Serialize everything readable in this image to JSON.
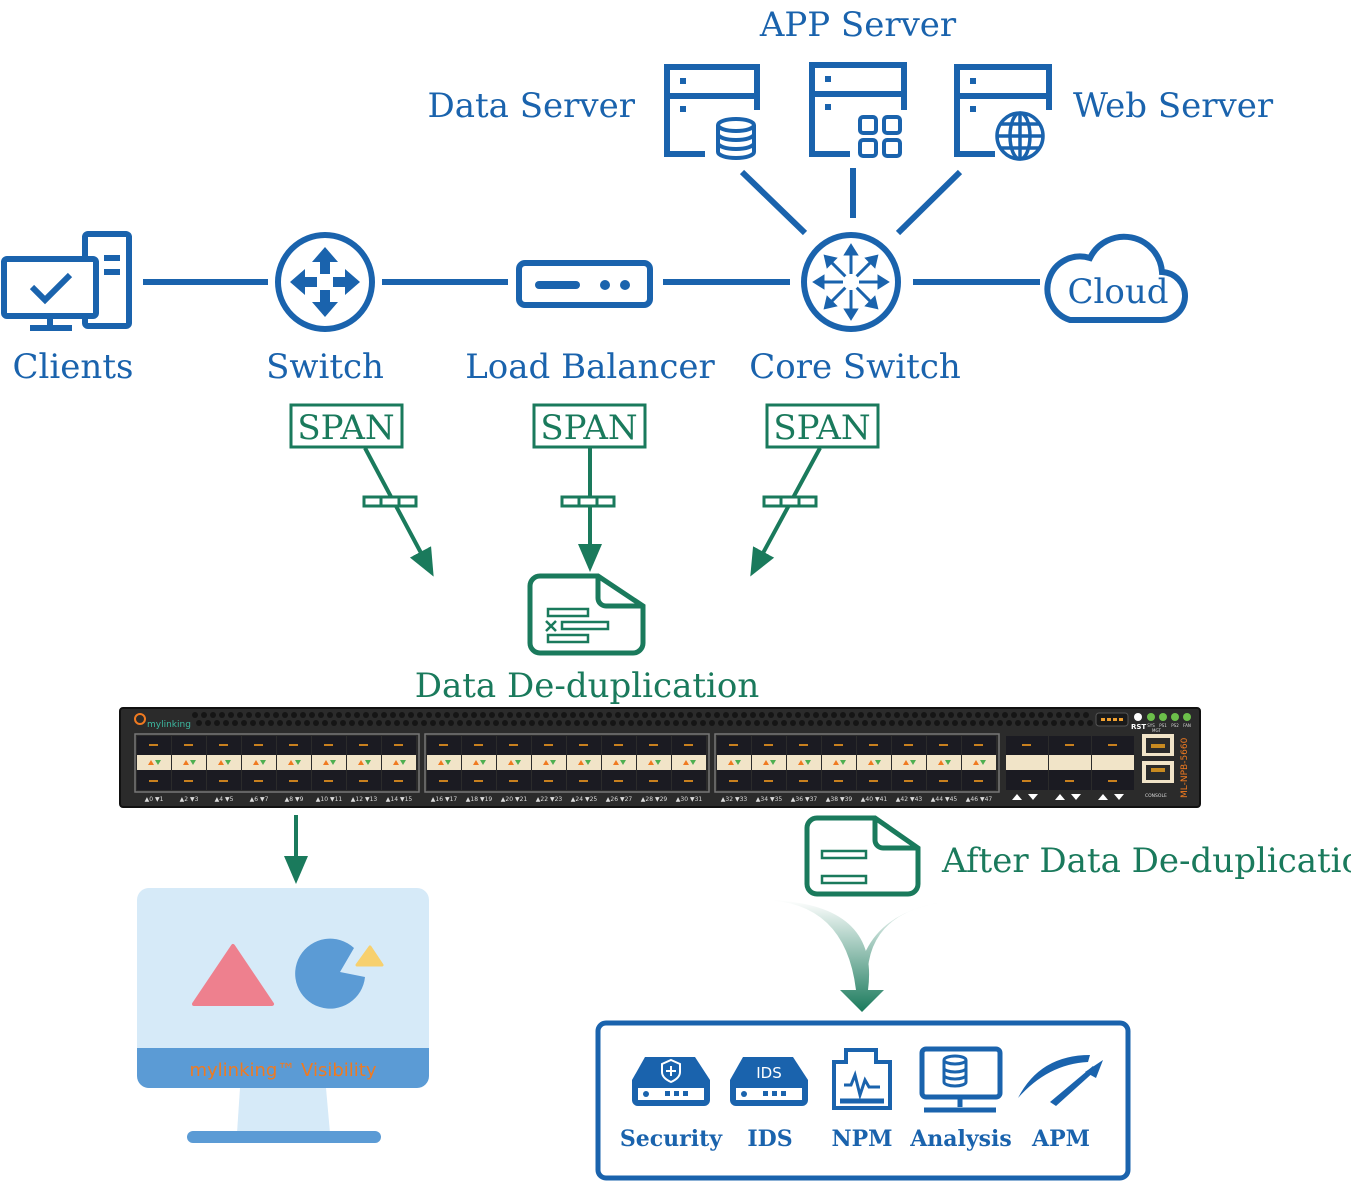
{
  "colors": {
    "blue": "#1a63ad",
    "green": "#1a7a5c",
    "device": "#2b2b2b",
    "port_accent": "#f1e4c8",
    "visibility_text": "#f07a20"
  },
  "servers": {
    "data": {
      "label": "Data Server",
      "icon": "database-server-icon"
    },
    "app": {
      "label": "APP Server",
      "icon": "app-server-icon"
    },
    "web": {
      "label": "Web Server",
      "icon": "web-server-icon"
    }
  },
  "nodes": {
    "clients": "Clients",
    "switch": "Switch",
    "load_balancer": "Load Balancer",
    "core_switch": "Core Switch",
    "cloud": "Cloud"
  },
  "span_label": "SPAN",
  "dedup_label": "Data De-duplication",
  "after_dedup_label": "After Data De-duplication",
  "device": {
    "brand": "mylinking",
    "model": "ML-NPB-5660",
    "rst": "RST",
    "mgt": "MGT",
    "console": "CONSOLE",
    "leds": [
      "SYS",
      "PS1",
      "PS2",
      "FAN"
    ],
    "port_labels": [
      "▲0 ▼1",
      "▲2 ▼3",
      "▲4 ▼5",
      "▲6 ▼7",
      "▲8 ▼9",
      "▲10 ▼11",
      "▲12 ▼13",
      "▲14 ▼15",
      "▲16 ▼17",
      "▲18 ▼19",
      "▲20 ▼21",
      "▲22 ▼23",
      "▲24 ▼25",
      "▲26 ▼27",
      "▲28 ▼29",
      "▲30 ▼31",
      "▲32 ▼33",
      "▲34 ▼35",
      "▲36 ▼37",
      "▲38 ▼39",
      "▲40 ▼41",
      "▲42 ▼43",
      "▲44 ▼45",
      "▲46 ▼47"
    ]
  },
  "visibility": {
    "label": "mylinking™ Visibility"
  },
  "tools": [
    {
      "label": "Security",
      "icon": "security-appliance-icon"
    },
    {
      "label": "IDS",
      "icon": "ids-appliance-icon",
      "badge": "IDS"
    },
    {
      "label": "NPM",
      "icon": "npm-icon"
    },
    {
      "label": "Analysis",
      "icon": "analysis-monitor-icon"
    },
    {
      "label": "APM",
      "icon": "apm-gauge-icon"
    }
  ]
}
